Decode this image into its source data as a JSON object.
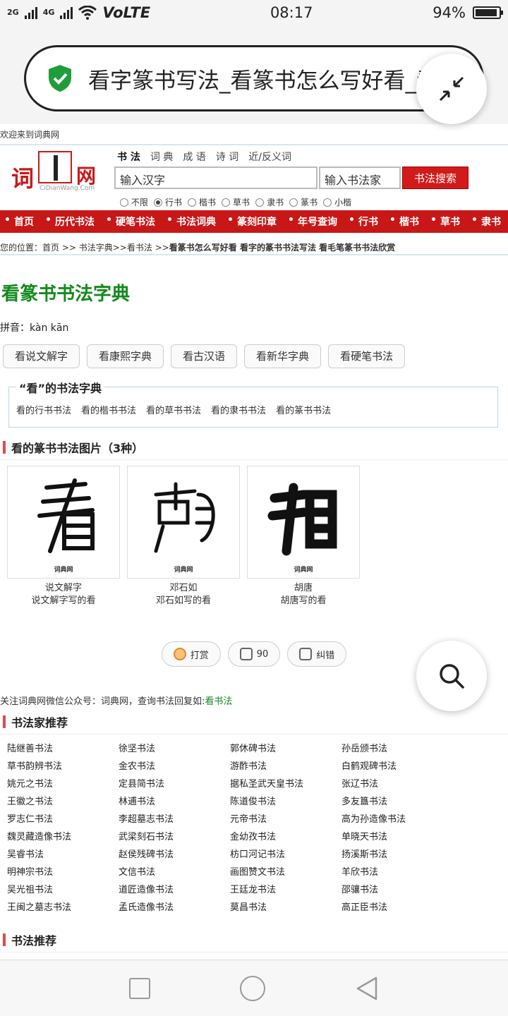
{
  "status_bar": {
    "network_1": "2G",
    "network_2": "4G",
    "volte": "VoLTE",
    "time": "08:17",
    "battery_pct": "94%",
    "battery_level": 0.94
  },
  "browser": {
    "url_title": "看字篆书写法_看篆书怎么写好看_看字",
    "secure_icon": "shield-check-icon",
    "collapse_icon": "collapse-arrows-icon"
  },
  "site": {
    "welcome": "欢迎来到词典网",
    "logo": {
      "char1": "词",
      "char3": "网",
      "sub": "CiDianWang.Com"
    },
    "search_tabs": [
      "书 法",
      "词 典",
      "成 语",
      "诗 词",
      "近/反义词"
    ],
    "search_input_placeholder": "输入汉字",
    "author_input_placeholder": "输入书法家",
    "search_button": "书法搜索",
    "radios": [
      "不限",
      "行书",
      "楷书",
      "草书",
      "隶书",
      "篆书",
      "小楷"
    ],
    "radio_selected": "行书",
    "nav": [
      "首页",
      "历代书法",
      "硬笔书法",
      "书法词典",
      "篆刻印章",
      "年号查询",
      "行书",
      "楷书",
      "草书",
      "隶书"
    ]
  },
  "breadcrumb": {
    "prefix": "您的位置：",
    "path": "首页 >> 书法字典>>看书法 >>",
    "current": "看篆书怎么写好看 看字的篆书书法写法 看毛笔篆书书法欣赏"
  },
  "main": {
    "title": "看篆书书法字典",
    "pinyin": "拼音：kàn kān",
    "dict_links": [
      "看说文解字",
      "看康熙字典",
      "看古汉语",
      "看新华字典",
      "看硬笔书法"
    ],
    "field_legend": "“看”的书法字典",
    "field_links": [
      "看的行书书法",
      "看的楷书书法",
      "看的草书书法",
      "看的隶书书法",
      "看的篆书书法"
    ],
    "images_heading": "看的篆书书法图片（3种）",
    "images": [
      {
        "watermark": "词典网",
        "author": "说文解字",
        "caption": "说文解字写的看"
      },
      {
        "watermark": "词典网",
        "author": "邓石如",
        "caption": "邓石如写的看"
      },
      {
        "watermark": "词典网",
        "author": "胡唐",
        "caption": "胡唐写的看"
      }
    ],
    "actions": {
      "reward": "打赏",
      "like_count": "90",
      "correct": "纠错"
    },
    "wechat_text": "关注词典网微信公众号：词典网，查询书法回复如:",
    "wechat_link": "看书法",
    "calligraphers_heading": "书法家推荐",
    "calligraphers": [
      "陆继善书法",
      "徐坚书法",
      "郭休碑书法",
      "孙岳颁书法",
      "草书韵辨书法",
      "金农书法",
      "游酢书法",
      "白鹤观碑书法",
      "姚元之书法",
      "定县简书法",
      "据私圣武天皇书法",
      "张辽书法",
      "王徽之书法",
      "林逋书法",
      "陈道俊书法",
      "多友簋书法",
      "罗志仁书法",
      "李超墓志书法",
      "元帝书法",
      "高为孙造像书法",
      "魏灵藏造像书法",
      "武梁刻石书法",
      "金幼孜书法",
      "单晓天书法",
      "吴睿书法",
      "赵侯残碑书法",
      "枋口河记书法",
      "扬溪斯书法",
      "明神宗书法",
      "文信书法",
      "画图赞文书法",
      "羊欣书法",
      "吴光祖书法",
      "道匠造像书法",
      "王廷龙书法",
      "邵骧书法",
      "王闽之墓志书法",
      "孟氏造像书法",
      "莫昌书法",
      "高正臣书法"
    ],
    "recommend_heading": "书法推荐"
  }
}
